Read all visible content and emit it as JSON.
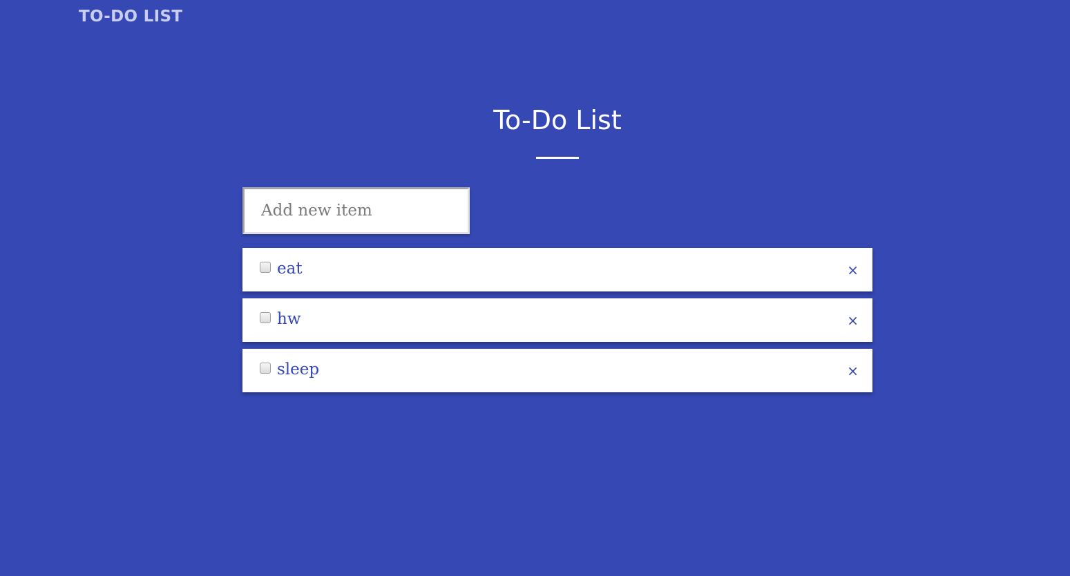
{
  "header": {
    "brand": "TO-DO LIST"
  },
  "main": {
    "title": "To-Do List",
    "new_item": {
      "placeholder": "Add new item",
      "value": ""
    },
    "items": [
      {
        "label": "eat",
        "checked": false,
        "delete_label": "×"
      },
      {
        "label": "hw",
        "checked": false,
        "delete_label": "×"
      },
      {
        "label": "sleep",
        "checked": false,
        "delete_label": "×"
      }
    ]
  },
  "colors": {
    "background": "#3548b4",
    "accent": "#3548b4",
    "card": "#ffffff"
  }
}
